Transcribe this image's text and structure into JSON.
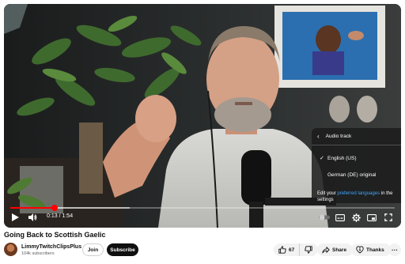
{
  "player": {
    "progress_fraction": 0.115,
    "buffered_fraction": 0.31,
    "time": "0:13 / 1:54",
    "audio_menu": {
      "title": "Audio track",
      "options": [
        {
          "label": "English (US)",
          "selected": true
        },
        {
          "label": "German (DE) original",
          "selected": false
        }
      ],
      "footer_prefix": "Edit your ",
      "footer_link": "preferred languages",
      "footer_suffix": " in the settings"
    },
    "controls": {
      "play_icon": "play-icon",
      "volume_icon": "volume-icon",
      "subtitles_icon": "subtitles-icon",
      "settings_icon": "settings-gear-icon",
      "miniplayer_icon": "miniplayer-icon",
      "fullscreen_icon": "fullscreen-icon"
    }
  },
  "video": {
    "title": "Going Back to Scottish Gaelic"
  },
  "channel": {
    "name": "LimmyTwitchClipsPlus",
    "subscribers": "104k subscribers",
    "join_label": "Join",
    "subscribe_label": "Subscribe"
  },
  "actions": {
    "like_count": "67",
    "share_label": "Share",
    "thanks_label": "Thanks",
    "more_label": "···"
  },
  "colors": {
    "accent": "#ff0000",
    "link": "#3ea6ff",
    "subscribe_bg": "#0f0f0f",
    "pill_bg": "#f2f2f2"
  }
}
